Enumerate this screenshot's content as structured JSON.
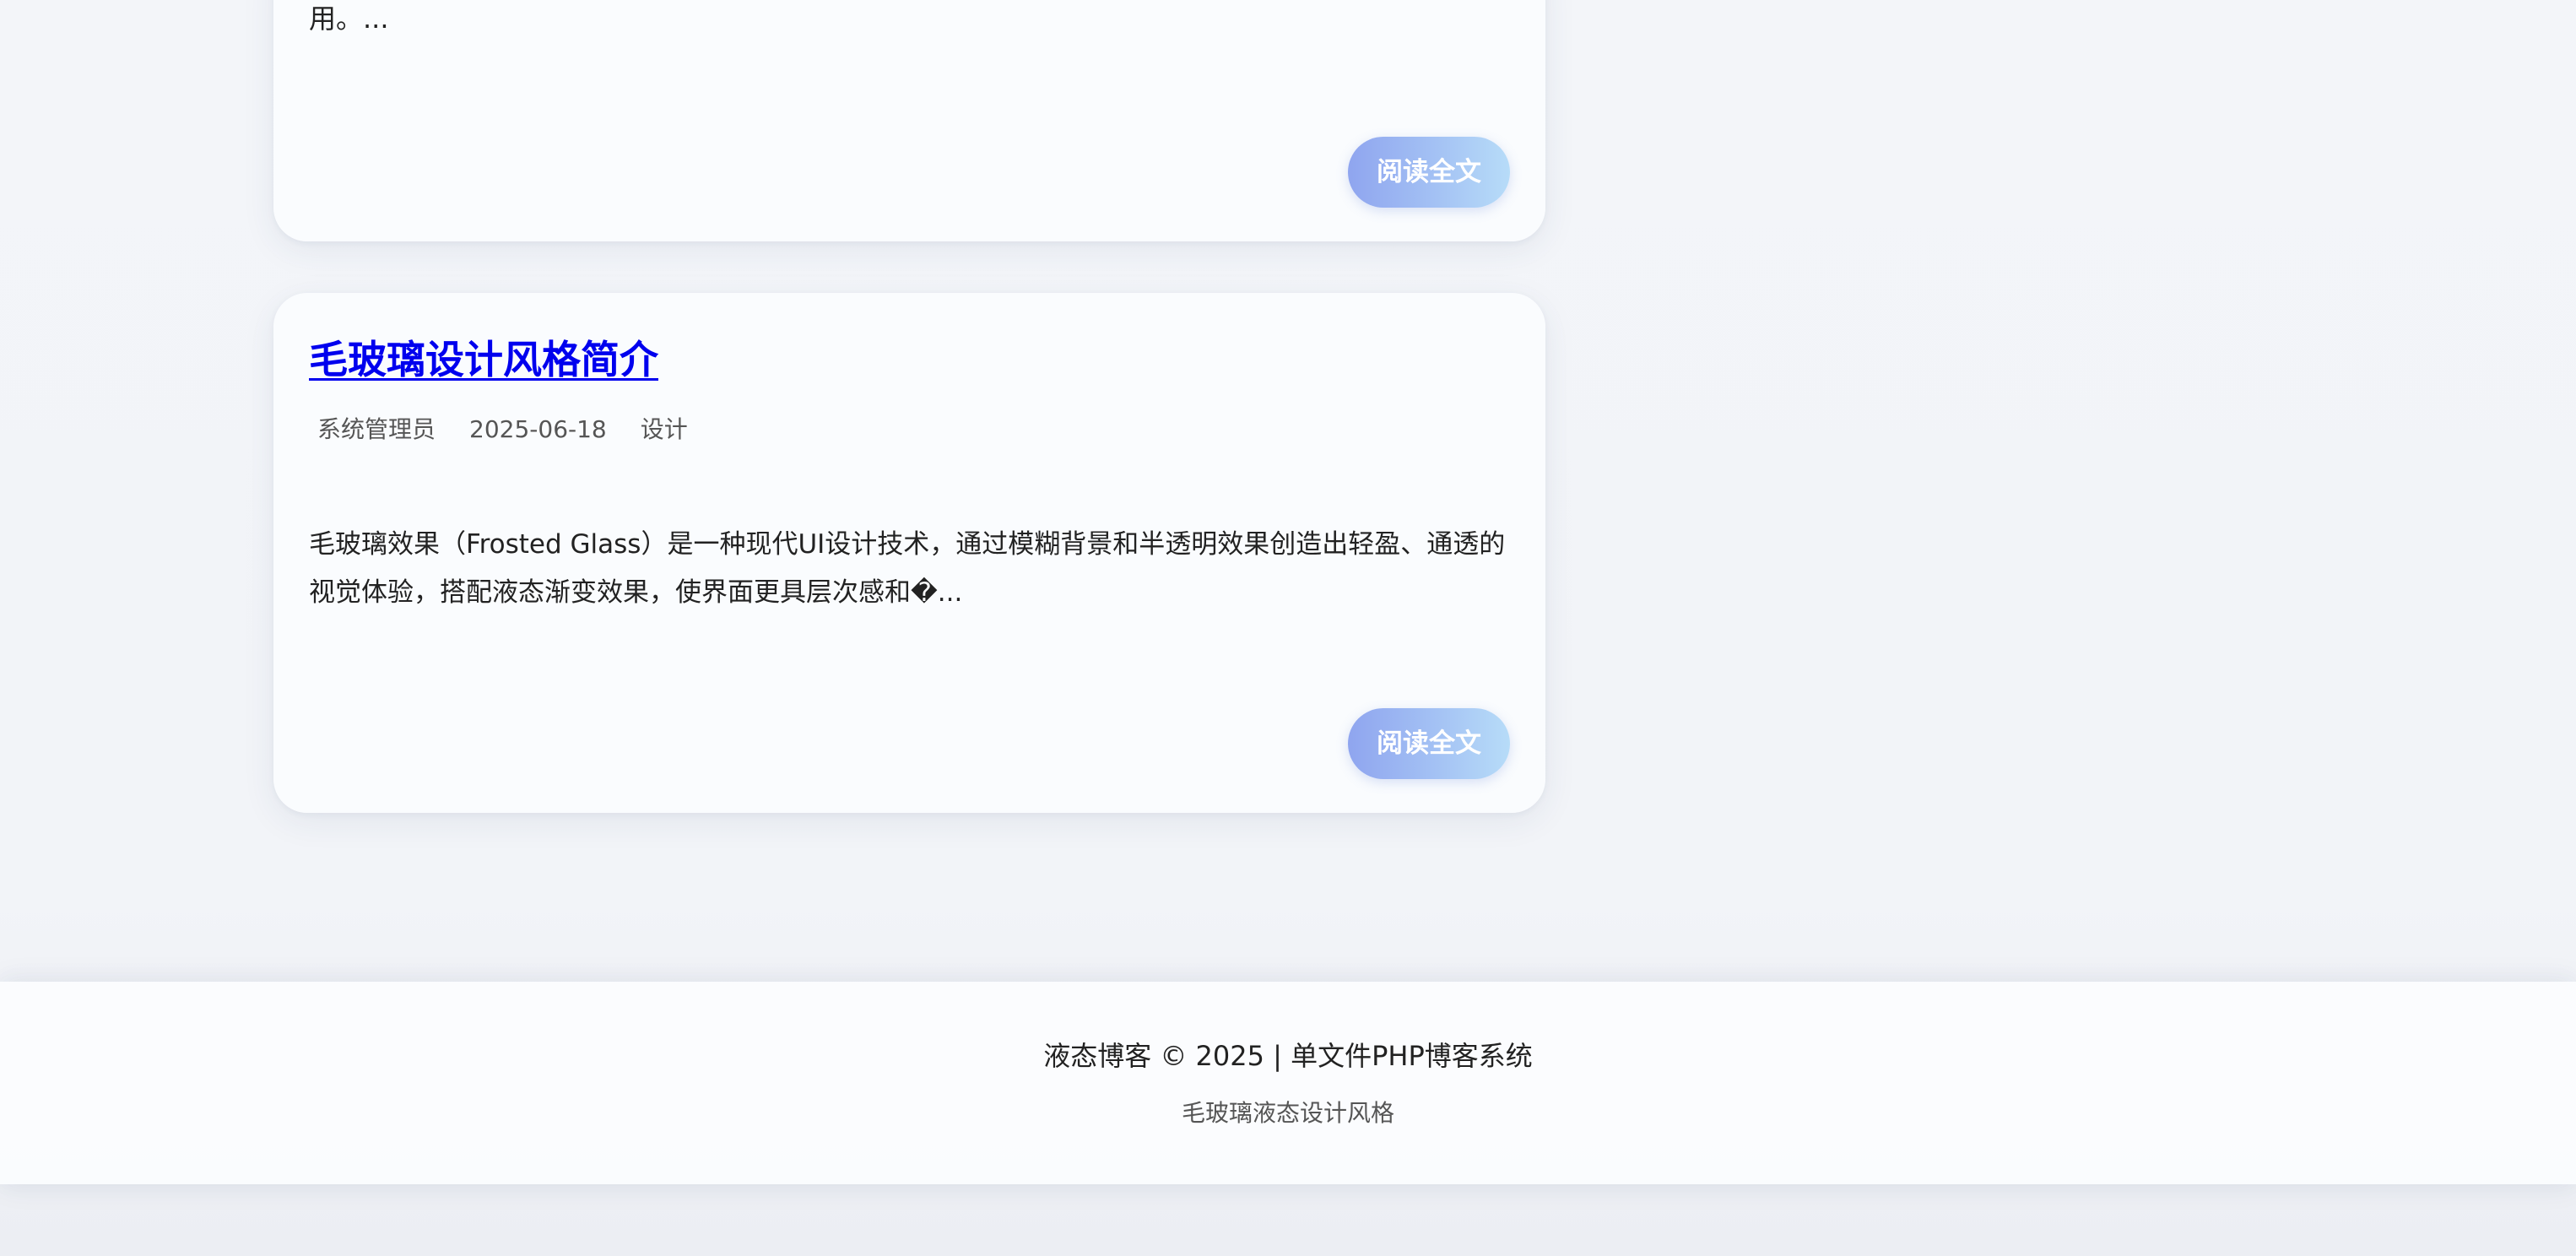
{
  "posts": [
    {
      "excerpt_tail": "用。...",
      "read_more": "阅读全文"
    },
    {
      "title": "毛玻璃设计风格简介",
      "author": "系统管理员",
      "date": "2025-06-18",
      "category": "设计",
      "excerpt": "毛玻璃效果（Frosted Glass）是一种现代UI设计技术，通过模糊背景和半透明效果创造出轻盈、通透的视觉体验，搭配液态渐变效果，使界面更具层次感和�...",
      "read_more": "阅读全文"
    }
  ],
  "footer": {
    "copyright": "液态博客 © 2025 | 单文件PHP博客系统",
    "tagline": "毛玻璃液态设计风格"
  },
  "colors": {
    "title_link": "#0000ee",
    "button_gradient_start": "#8fa5ef",
    "button_gradient_end": "#b7dcf8",
    "card_background": "#fbfcfe",
    "page_background": "#f2f4f8"
  }
}
